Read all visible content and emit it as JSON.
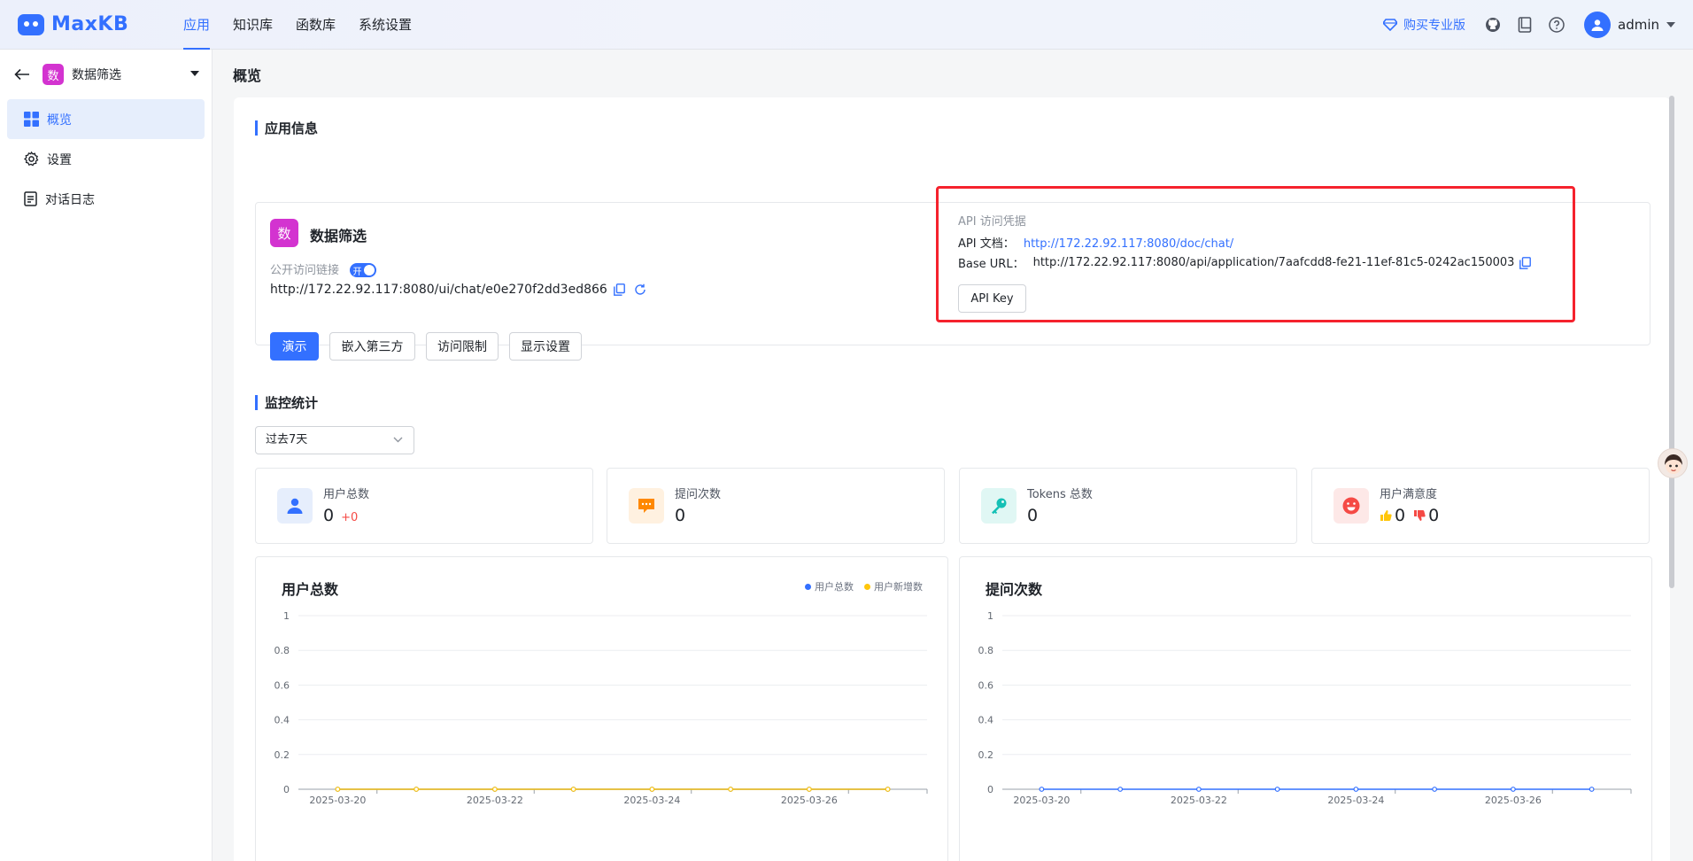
{
  "header": {
    "logo_text": "MaxKB",
    "nav": [
      {
        "label": "应用",
        "active": true
      },
      {
        "label": "知识库"
      },
      {
        "label": "函数库"
      },
      {
        "label": "系统设置"
      }
    ],
    "buy_label": "购买专业版",
    "user_name": "admin",
    "accent_color": "#3370ff"
  },
  "sidebar": {
    "app_badge": "数",
    "app_name": "数据筛选",
    "items": [
      {
        "label": "概览",
        "icon": "grid-icon",
        "active": true
      },
      {
        "label": "设置",
        "icon": "gear-icon"
      },
      {
        "label": "对话日志",
        "icon": "document-icon"
      }
    ]
  },
  "page": {
    "title": "概览"
  },
  "app_info": {
    "section_title": "应用信息",
    "badge": "数",
    "name": "数据筛选",
    "public_link_label": "公开访问链接",
    "toggle_label": "开",
    "public_url": "http://172.22.92.117:8080/ui/chat/e0e270f2dd3ed866",
    "buttons": [
      "演示",
      "嵌入第三方",
      "访问限制",
      "显示设置"
    ],
    "api": {
      "title": "API 访问凭据",
      "doc_label": "API 文档：",
      "doc_url": "http://172.22.92.117:8080/doc/chat/",
      "base_label": "Base URL：",
      "base_url": "http://172.22.92.117:8080/api/application/7aafcdd8-fe21-11ef-81c5-0242ac150003",
      "key_button": "API Key"
    }
  },
  "monitor": {
    "section_title": "监控统计",
    "range_select": "过去7天",
    "stats": [
      {
        "label": "用户总数",
        "value": "0",
        "delta": "+0",
        "icon": "user-icon",
        "color": "#3370ff"
      },
      {
        "label": "提问次数",
        "value": "0",
        "icon": "chat-bubble-icon",
        "color": "#ff8800"
      },
      {
        "label": "Tokens 总数",
        "value": "0",
        "icon": "key-icon",
        "color": "#14c0b5"
      },
      {
        "label": "用户满意度",
        "like": "0",
        "dislike": "0",
        "icon": "smile-icon",
        "color": "#f54a45"
      }
    ]
  },
  "chart_data": [
    {
      "type": "line",
      "title": "用户总数",
      "x": [
        "2025-03-20",
        "2025-03-21",
        "2025-03-22",
        "2025-03-23",
        "2025-03-24",
        "2025-03-25",
        "2025-03-26",
        "2025-03-27"
      ],
      "x_tick_labels": [
        "2025-03-20",
        "2025-03-22",
        "2025-03-24",
        "2025-03-26"
      ],
      "series": [
        {
          "name": "用户总数",
          "values": [
            0,
            0,
            0,
            0,
            0,
            0,
            0,
            0
          ],
          "color": "#3370ff"
        },
        {
          "name": "用户新增数",
          "values": [
            0,
            0,
            0,
            0,
            0,
            0,
            0,
            0
          ],
          "color": "#ffc60a"
        }
      ],
      "ylim": [
        0,
        1
      ],
      "y_ticks": [
        "1",
        "0.8",
        "0.6",
        "0.4",
        "0.2",
        "0"
      ],
      "legend": "top-right",
      "grid": true
    },
    {
      "type": "line",
      "title": "提问次数",
      "x": [
        "2025-03-20",
        "2025-03-21",
        "2025-03-22",
        "2025-03-23",
        "2025-03-24",
        "2025-03-25",
        "2025-03-26",
        "2025-03-27"
      ],
      "x_tick_labels": [
        "2025-03-20",
        "2025-03-22",
        "2025-03-24",
        "2025-03-26"
      ],
      "series": [
        {
          "values": [
            0,
            0,
            0,
            0,
            0,
            0,
            0,
            0
          ],
          "color": "#3370ff"
        }
      ],
      "ylim": [
        0,
        1
      ],
      "y_ticks": [
        "1",
        "0.8",
        "0.6",
        "0.4",
        "0.2",
        "0"
      ],
      "grid": true
    }
  ]
}
